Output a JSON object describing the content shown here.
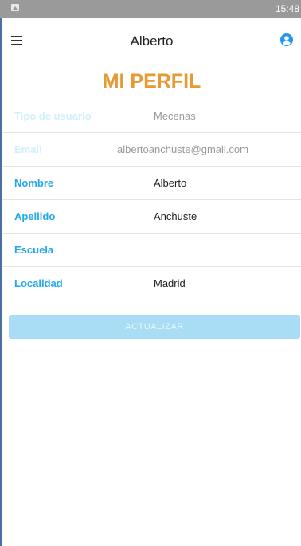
{
  "status_bar": {
    "time": "15:48"
  },
  "app_bar": {
    "title": "Alberto"
  },
  "page": {
    "title": "MI PERFIL"
  },
  "form": {
    "fields": [
      {
        "label": "Tipo de usuario",
        "value": "Mecenas",
        "enabled": false
      },
      {
        "label": "Email",
        "value": "albertoanchuste@gmail.com",
        "enabled": false
      },
      {
        "label": "Nombre",
        "value": "Alberto",
        "enabled": true
      },
      {
        "label": "Apellido",
        "value": "Anchuste",
        "enabled": true
      },
      {
        "label": "Escuela",
        "value": "",
        "enabled": true
      },
      {
        "label": "Localidad",
        "value": "Madrid",
        "enabled": true
      }
    ]
  },
  "actions": {
    "update_label": "ACTUALIZAR"
  },
  "colors": {
    "accent": "#24a9e8",
    "title": "#e69a32",
    "button_disabled": "#a9ddf5"
  },
  "icons": {
    "status": "image-icon",
    "menu": "menu-icon",
    "account": "user-icon"
  }
}
